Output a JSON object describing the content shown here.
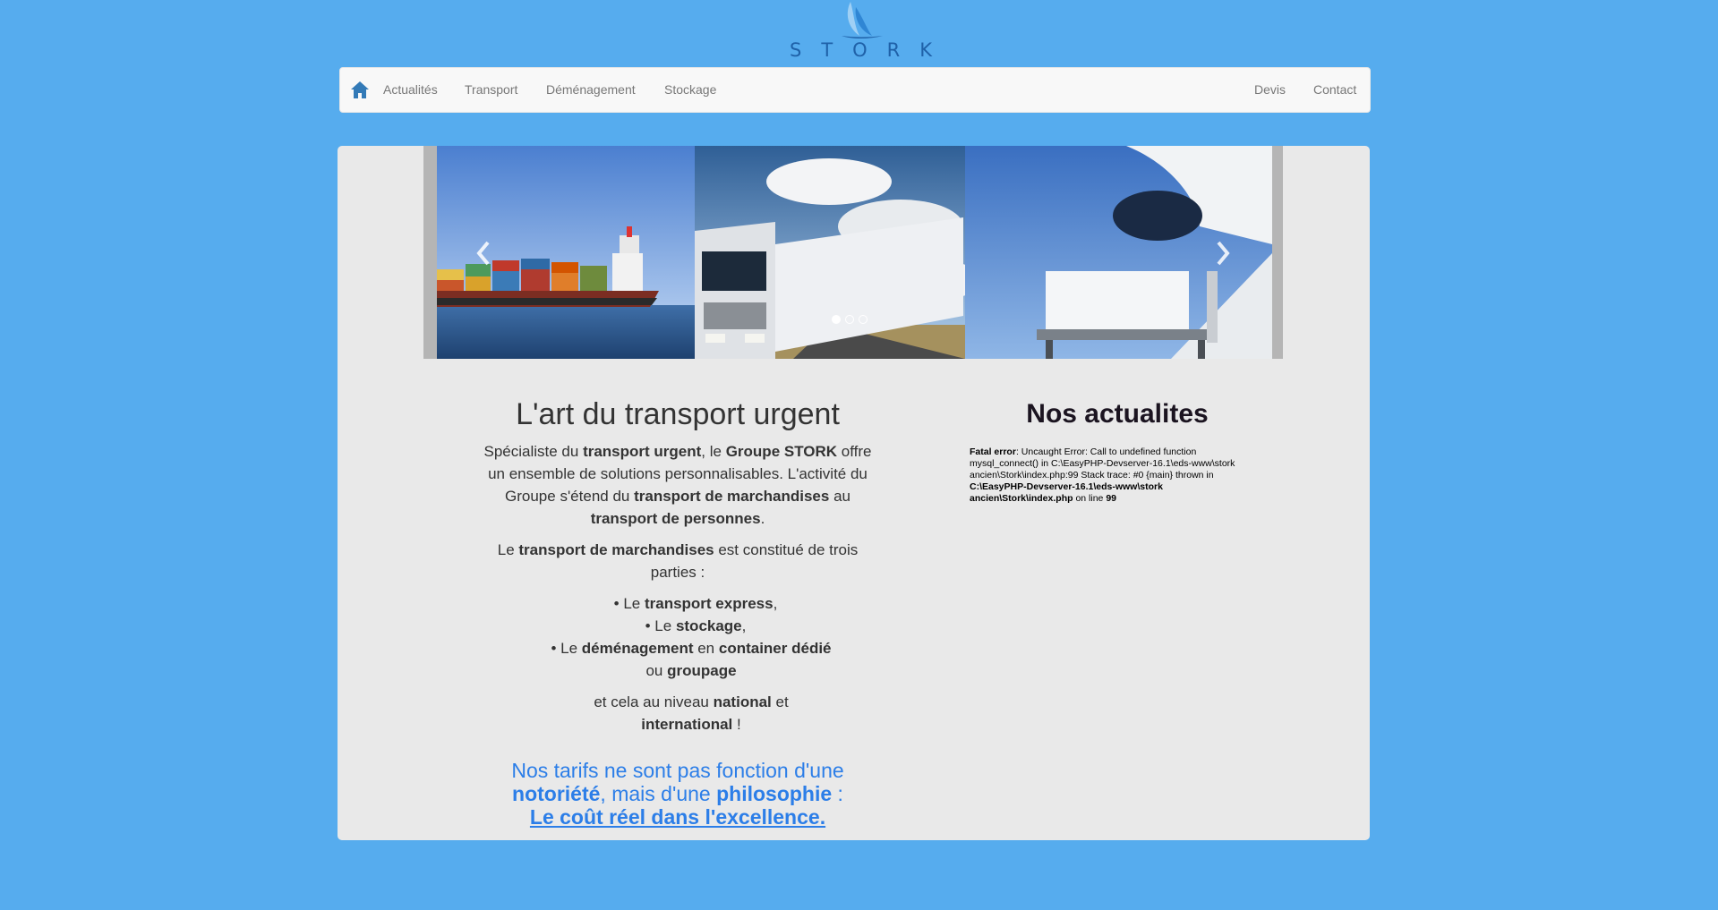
{
  "logo": {
    "text": "STORK"
  },
  "nav": {
    "left": [
      "Actualités",
      "Transport",
      "Déménagement",
      "Stockage"
    ],
    "right": [
      "Devis",
      "Contact"
    ]
  },
  "carousel": {
    "slides": [
      "cargo-ship",
      "truck",
      "cargo-plane"
    ],
    "active_index": 0
  },
  "intro": {
    "title": "L'art du transport urgent",
    "p1": {
      "a": "Spécialiste du ",
      "b": "transport urgent",
      "c": ", le ",
      "d": "Groupe STORK",
      "e": " offre un ensemble de solutions personnalisables. L'activité du Groupe s'étend du ",
      "f": "transport de marchandises",
      "g": " au ",
      "h": "transport de personnes",
      "i": "."
    },
    "p2": {
      "a": "Le ",
      "b": "transport de marchandises",
      "c": " est constitué de trois parties :"
    },
    "items": [
      {
        "pre": "• Le ",
        "bold": "transport express",
        "post": ","
      },
      {
        "pre": "• Le ",
        "bold": "stockage",
        "post": ","
      },
      {
        "pre": "• Le ",
        "bold": "déménagement",
        "mid": " en ",
        "bold2": "container dédié",
        "mid2": " ou ",
        "bold3": "groupage"
      }
    ],
    "p3": {
      "a": "et cela au niveau ",
      "b": "national",
      "c": " et ",
      "d": "international",
      "e": " !"
    },
    "slogan": {
      "a": "Nos tarifs ne sont pas fonction d'une ",
      "b": "notoriété",
      "c": ", mais d'une ",
      "d": "philosophie",
      "e": " :",
      "link": "Le coût réel dans l'excellence."
    }
  },
  "news": {
    "title": "Nos actualites",
    "error": {
      "label": "Fatal error",
      "message": ": Uncaught Error: Call to undefined function mysql_connect() in C:\\EasyPHP-Devserver-16.1\\eds-www\\stork ancien\\Stork\\index.php:99 Stack trace: #0 {main} thrown in ",
      "file": "C:\\EasyPHP-Devserver-16.1\\eds-www\\stork ancien\\Stork\\index.php",
      "mid": " on line ",
      "line": "99"
    }
  },
  "colors": {
    "background": "#56acee",
    "accent": "#2c7ee8",
    "brand": "#1f61a8"
  }
}
